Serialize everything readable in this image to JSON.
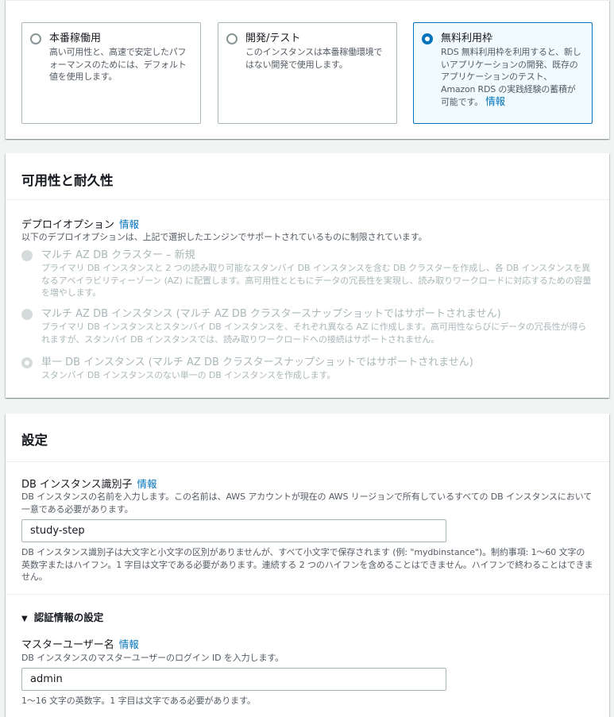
{
  "templates": {
    "options": [
      {
        "title": "本番稼働用",
        "desc": "高い可用性と、高速で安定したパフォーマンスのためには、デフォルト値を使用します。",
        "selected": false
      },
      {
        "title": "開発/テスト",
        "desc": "このインスタンスは本番稼働環境ではない開発で使用します。",
        "selected": false
      },
      {
        "title": "無料利用枠",
        "desc": "RDS 無料利用枠を利用すると、新しいアプリケーションの開発、既存のアプリケーションのテスト、Amazon RDS の実践経験の蓄積が可能です。",
        "info": "情報",
        "selected": true
      }
    ]
  },
  "availability": {
    "title": "可用性と耐久性",
    "deploy_label": "デプロイオプション",
    "deploy_info": "情報",
    "deploy_desc": "以下のデプロイオプションは、上記で選択したエンジンでサポートされているものに制限されています。",
    "options": [
      {
        "title": "マルチ AZ DB クラスター – 新規",
        "desc": "プライマリ DB インスタンスと 2 つの読み取り可能なスタンバイ DB インスタンスを含む DB クラスターを作成し、各 DB インスタンスを異なるアベイラビリティーゾーン (AZ) に配置します。高可用性とともにデータの冗長性を実現し、読み取りワークロードに対応するための容量を増やします。"
      },
      {
        "title": "マルチ AZ DB インスタンス (マルチ AZ DB クラスタースナップショットではサポートされません)",
        "desc": "プライマリ DB インスタンスとスタンバイ DB インスタンスを、それぞれ異なる AZ に作成します。高可用性ならびにデータの冗長性が得られますが、スタンバイ DB インスタンスでは、読み取りワークロードへの接続はサポートされません。"
      },
      {
        "title": "単一 DB インスタンス (マルチ AZ DB クラスタースナップショットではサポートされません)",
        "desc": "スタンバイ DB インスタンスのない単一の DB インスタンスを作成します。"
      }
    ]
  },
  "settings": {
    "title": "設定",
    "identifier_label": "DB インスタンス識別子",
    "identifier_info": "情報",
    "identifier_desc": "DB インスタンスの名前を入力します。この名前は、AWS アカウントが現在の AWS リージョンで所有しているすべての DB インスタンスにおいて一意である必要があります。",
    "identifier_value": "study-step",
    "identifier_hint": "DB インスタンス識別子は大文字と小文字の区別がありませんが、すべて小文字で保存されます (例: \"mydbinstance\")。制約事項: 1～60 文字の英数字またはハイフン。1 字目は文字である必要があります。連続する 2 つのハイフンを含めることはできません。ハイフンで終わることはできません。",
    "credentials_label": "認証情報の設定",
    "master_label": "マスターユーザー名",
    "master_info": "情報",
    "master_desc": "DB インスタンスのマスターユーザーのログイン ID を入力します。",
    "master_value": "admin",
    "master_hint": "1～16 文字の英数字。1 字目は文字である必要があります。"
  }
}
